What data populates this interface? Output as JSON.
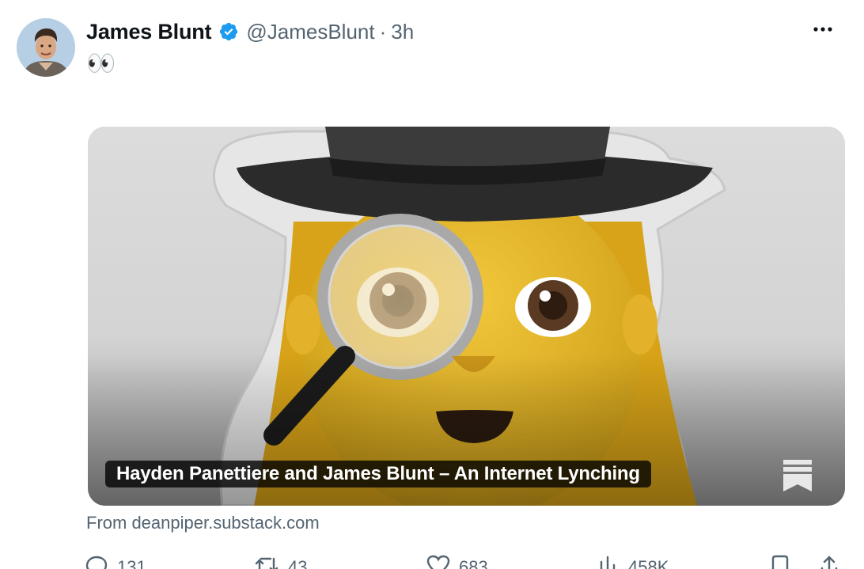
{
  "tweet": {
    "author_name": "James Blunt",
    "handle": "@JamesBlunt",
    "separator": "·",
    "time": "3h",
    "text": "👀"
  },
  "card": {
    "title": "Hayden Panettiere and James Blunt – An Internet Lynching",
    "source": "From deanpiper.substack.com",
    "image_icon": "detective-emoji-image"
  },
  "actions": {
    "replies": "131",
    "reposts": "43",
    "likes": "683",
    "views": "458K"
  },
  "colors": {
    "verified": "#1d9bf0",
    "secondary_text": "#536471",
    "primary_text": "#0f1419"
  }
}
